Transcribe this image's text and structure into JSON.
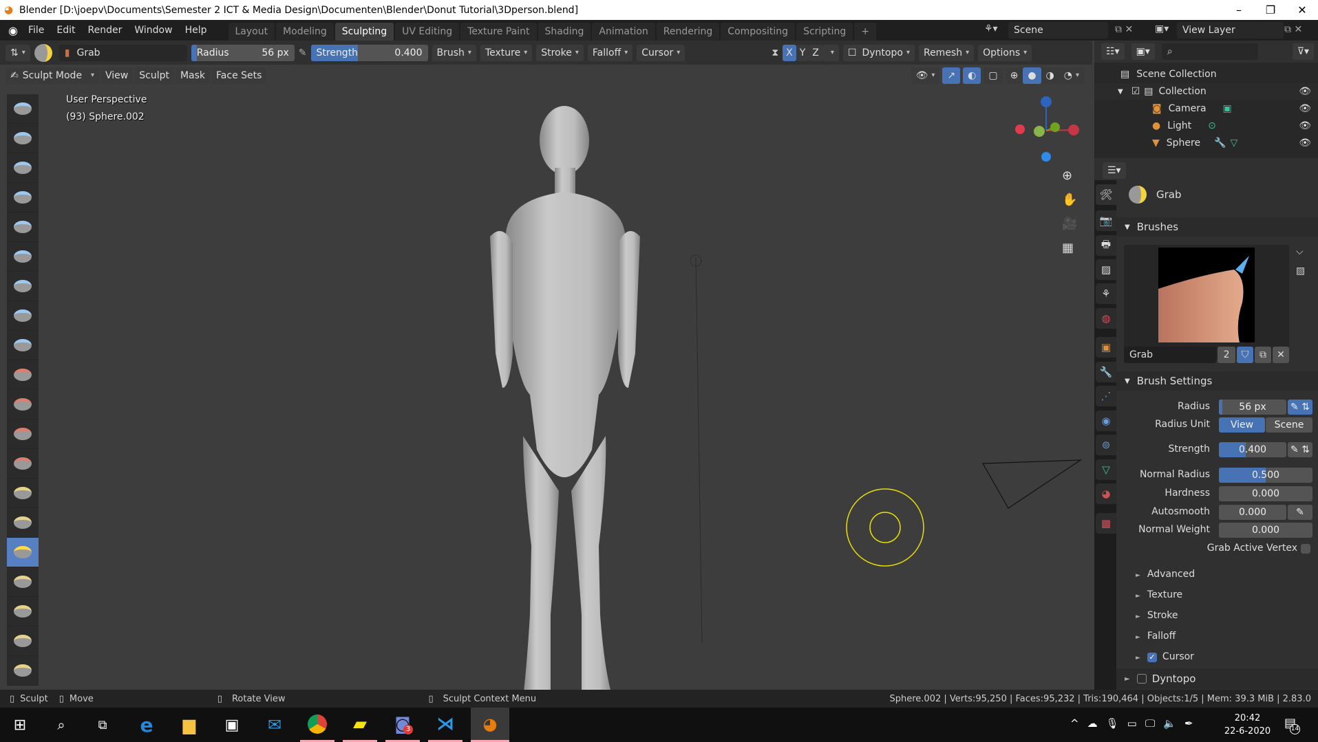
{
  "window": {
    "title": "Blender [D:\\joepv\\Documents\\Semester 2 ICT & Media Design\\Documenten\\Blender\\Donut Tutorial\\3Dperson.blend]",
    "minimize": "–",
    "maximize": "❐",
    "close": "✕"
  },
  "menu": [
    "File",
    "Edit",
    "Render",
    "Window",
    "Help"
  ],
  "workspaces": [
    "Layout",
    "Modeling",
    "Sculpting",
    "UV Editing",
    "Texture Paint",
    "Shading",
    "Animation",
    "Rendering",
    "Compositing",
    "Scripting"
  ],
  "active_workspace": "Sculpting",
  "add_workspace": "+",
  "scene": {
    "name": "Scene",
    "view_layer": "View Layer"
  },
  "tool_header": {
    "brush_name": "Grab",
    "radius_label": "Radius",
    "radius_value": "56 px",
    "strength_label": "Strength",
    "strength_value": "0.400",
    "strength_fraction": 0.4,
    "menus": [
      "Brush",
      "Texture",
      "Stroke",
      "Falloff",
      "Cursor"
    ],
    "axes": [
      "X",
      "Y",
      "Z"
    ],
    "dyntopo": "Dyntopo",
    "remesh": "Remesh",
    "options": "Options"
  },
  "view_header": {
    "mode": "Sculpt Mode",
    "menus": [
      "View",
      "Sculpt",
      "Mask",
      "Face Sets"
    ]
  },
  "viewport": {
    "perspective": "User Perspective",
    "object": "(93) Sphere.002",
    "gizmo_axes": [
      "X",
      "Y",
      "Z"
    ]
  },
  "accent_color": "#4772b3",
  "cursor_color": "#e8e000",
  "outliner": {
    "root": "Scene Collection",
    "items": [
      {
        "name": "Collection",
        "icon": "collection-icon"
      },
      {
        "name": "Camera",
        "icon": "camera-icon"
      },
      {
        "name": "Light",
        "icon": "light-icon"
      },
      {
        "name": "Sphere",
        "icon": "mesh-icon"
      }
    ]
  },
  "properties": {
    "tool_name": "Grab",
    "brushes_title": "Brushes",
    "brush_name": "Grab",
    "brush_users": "2",
    "brush_settings_title": "Brush Settings",
    "fields": [
      {
        "label": "Radius",
        "value": "56 px",
        "fraction": 0.05
      },
      {
        "label": "Strength",
        "value": "0.400",
        "fraction": 0.4
      },
      {
        "label": "Normal Radius",
        "value": "0.500",
        "fraction": 0.5
      },
      {
        "label": "Hardness",
        "value": "0.000",
        "fraction": 0
      },
      {
        "label": "Autosmooth",
        "value": "0.000",
        "fraction": 0
      },
      {
        "label": "Normal Weight",
        "value": "0.000",
        "fraction": 0
      }
    ],
    "radius_unit_label": "Radius Unit",
    "radius_unit_options": [
      "View",
      "Scene"
    ],
    "radius_unit_selected": "View",
    "grab_active_vertex": "Grab Active Vertex",
    "subpanels": [
      "Advanced",
      "Texture",
      "Stroke",
      "Falloff"
    ],
    "cursor": "Cursor",
    "dyntopo": "Dyntopo"
  },
  "statusbar": {
    "left": [
      "Sculpt",
      "Move",
      "Rotate View",
      "Sculpt Context Menu"
    ],
    "stats": "Sphere.002 | Verts:95,250 | Faces:95,232 | Tris:190,464 | Objects:1/5 | Mem: 39.3 MiB | 2.83.0"
  },
  "taskbar": {
    "time": "20:42",
    "date": "22-6-2020",
    "notifications": "14",
    "discord_badge": "3"
  }
}
